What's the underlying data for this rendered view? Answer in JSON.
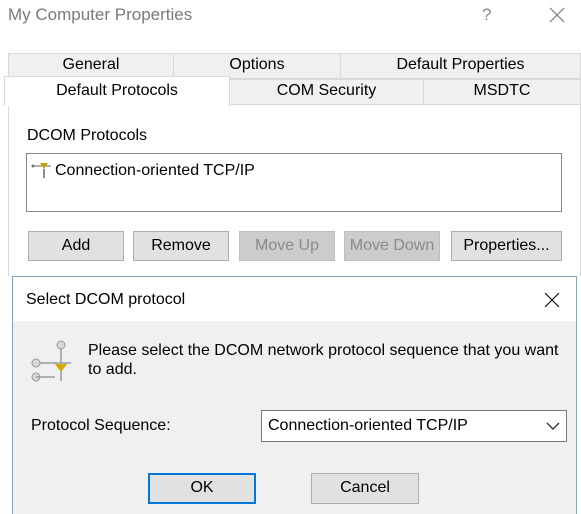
{
  "outer": {
    "title": "My Computer Properties",
    "help": "?",
    "tabs_row1": [
      "General",
      "Options",
      "Default Properties"
    ],
    "tabs_row2": [
      "Default Protocols",
      "COM Security",
      "MSDTC"
    ],
    "protocols_label": "DCOM Protocols",
    "protocols": [
      "Connection-oriented TCP/IP"
    ],
    "buttons": {
      "add": "Add",
      "remove": "Remove",
      "move_up": "Move Up",
      "move_down": "Move Down",
      "properties": "Properties..."
    }
  },
  "inner": {
    "title": "Select DCOM protocol",
    "message": "Please select the DCOM network protocol sequence that you want to add.",
    "sequence_label": "Protocol Sequence:",
    "sequence_value": "Connection-oriented TCP/IP",
    "ok": "OK",
    "cancel": "Cancel"
  },
  "colors": {
    "dialog_bg": "#f0f0f0",
    "button_bg": "#e1e1e1",
    "focus_blue": "#0078d7",
    "tab_border": "#d9d9d9"
  },
  "icons": [
    "close-icon",
    "network-protocol-icon",
    "chevron-down-icon"
  ]
}
